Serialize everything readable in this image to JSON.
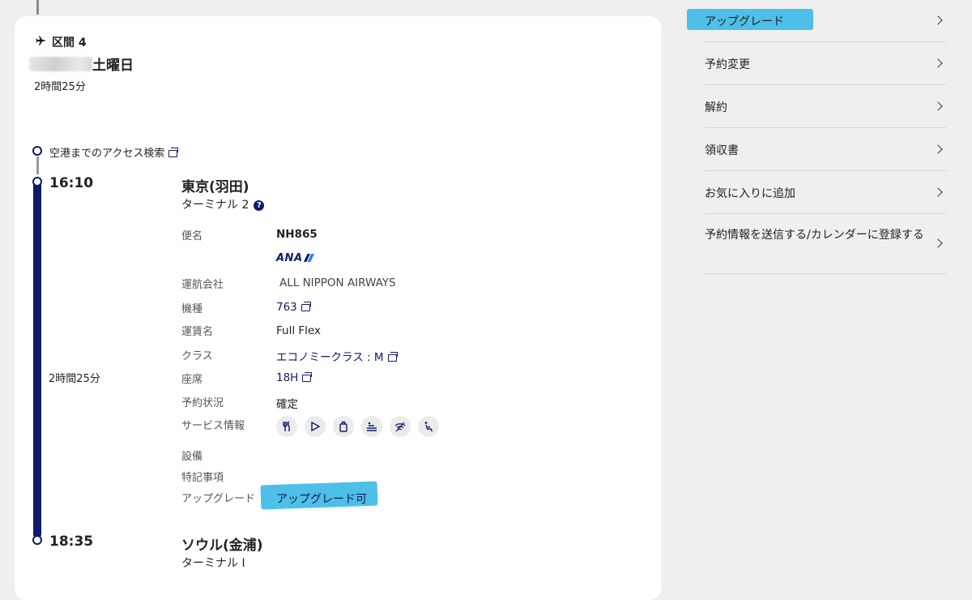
{
  "segment": {
    "heading": "区間 4",
    "date": "土曜日",
    "duration": "2時間25分",
    "access_link": "空港までのアクセス検索",
    "departure": {
      "time": "16:10",
      "city": "東京(羽田)",
      "terminal": "ターミナル 2"
    },
    "arrival": {
      "time": "18:35",
      "city": "ソウル(金浦)",
      "terminal": "ターミナル I"
    },
    "flight_duration": "2時間25分",
    "details": {
      "flight_label": "便名",
      "flight_value": "NH865",
      "airline_logo": "ANA",
      "operator_label": "運航会社",
      "operator_value": "ALL NIPPON AIRWAYS",
      "aircraft_label": "機種",
      "aircraft_value": "763",
      "fare_label": "運賃名",
      "fare_value": "Full Flex",
      "class_label": "クラス",
      "class_value": "エコノミークラス : M",
      "seat_label": "座席",
      "seat_value": "18H",
      "status_label": "予約状況",
      "status_value": "確定",
      "service_label": "サービス情報",
      "facility_label": "設備",
      "remarks_label": "特記事項",
      "upgrade_label": "アップグレード",
      "upgrade_value": "アップグレード可"
    },
    "service_icons": [
      "meal-icon",
      "entertainment-icon",
      "power-icon",
      "seat-flat-icon",
      "wifi-off-icon",
      "seat-recline-icon"
    ]
  },
  "side_menu": [
    "アップグレード",
    "予約変更",
    "解約",
    "領収書",
    "お気に入りに追加",
    "予約情報を送信する/カレンダーに登録する"
  ],
  "colors": {
    "accent": "#0f1a6b",
    "highlight": "#4dbfe8",
    "background": "#efefef"
  }
}
